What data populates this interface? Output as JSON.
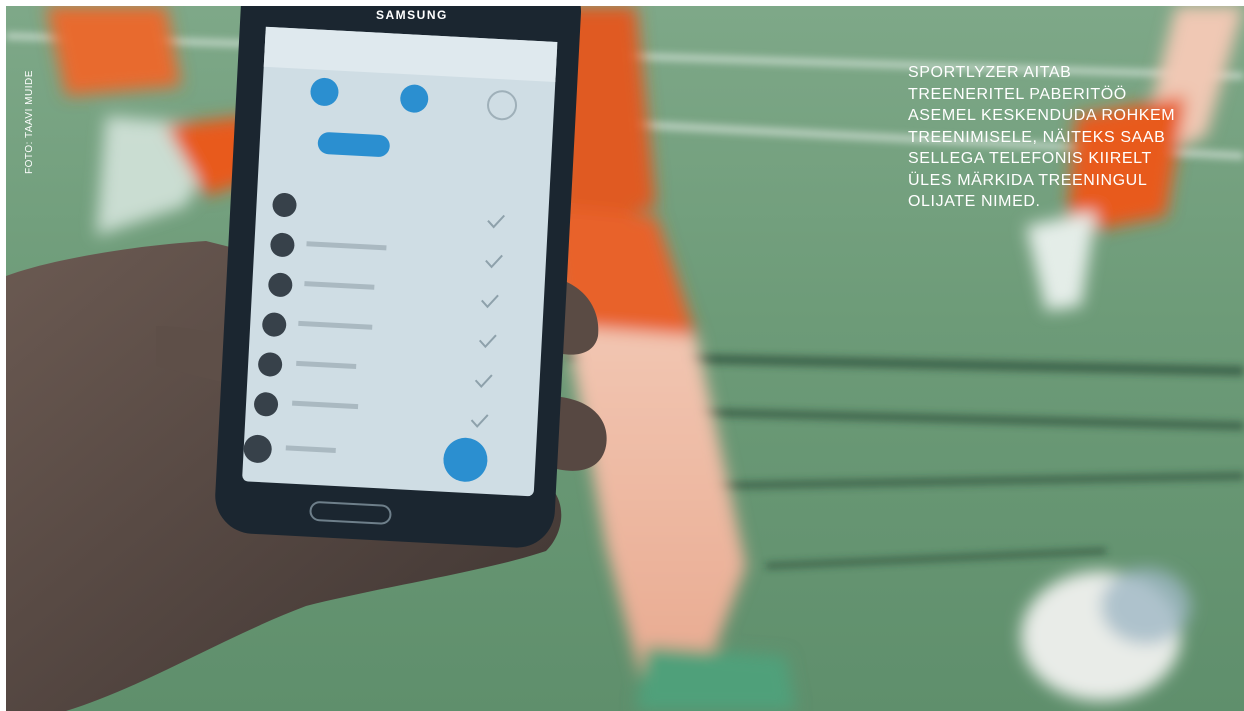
{
  "photo_credit": "FOTO: TAAVI MUIDE",
  "caption_lines": [
    "SPORTLYZER AITAB",
    "TREENERITEL PABERITÖÖ",
    "ASEMEL KESKENDUDA ROHKEM",
    "TREENIMISELE, NÄITEKS SAAB",
    "SELLEGA TELEFONIS KIIRELT",
    "ÜLES MÄRKIDA TREENINGUL",
    "OLIJATE NIMED."
  ],
  "phone_brand": "SAMSUNG",
  "colors": {
    "grass": "#6d9b78",
    "jersey": "#e85a1e",
    "app_accent": "#2b8fd0",
    "caption": "#ffffff"
  }
}
